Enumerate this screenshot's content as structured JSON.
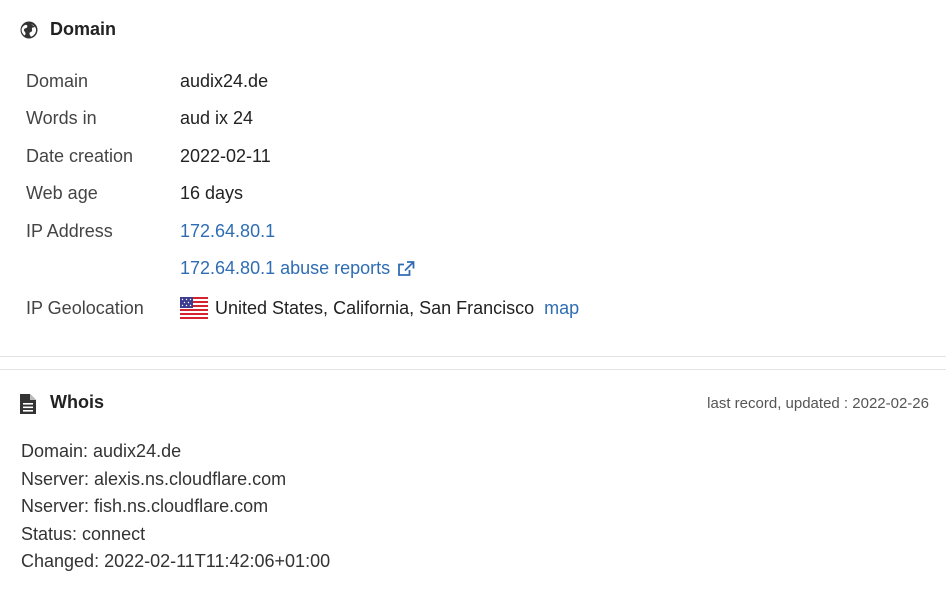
{
  "domain_section": {
    "title": "Domain",
    "rows": [
      {
        "label": "Domain",
        "value": "audix24.de"
      },
      {
        "label": "Words in",
        "value": "aud ix 24"
      },
      {
        "label": "Date creation",
        "value": "2022-02-11"
      },
      {
        "label": "Web age",
        "value": "16 days"
      },
      {
        "label": "IP Address",
        "value": "172.64.80.1"
      }
    ],
    "abuse_link": "172.64.80.1 abuse reports",
    "geolocation": {
      "label": "IP Geolocation",
      "value": "United States, California, San Francisco",
      "map_link": "map"
    }
  },
  "whois_section": {
    "title": "Whois",
    "updated": "last record, updated : 2022-02-26",
    "lines": [
      "Domain: audix24.de",
      "Nserver: alexis.ns.cloudflare.com",
      "Nserver: fish.ns.cloudflare.com",
      "Status: connect",
      "Changed: 2022-02-11T11:42:06+01:00"
    ]
  },
  "colors": {
    "link": "#2f6db3",
    "text": "#222222",
    "label": "#444444",
    "divider": "#e3e3e3"
  },
  "icons": {
    "domain_header": "globe-icon",
    "whois_header": "document-icon",
    "abuse_link": "external-link-icon",
    "geolocation": "us-flag-icon"
  }
}
